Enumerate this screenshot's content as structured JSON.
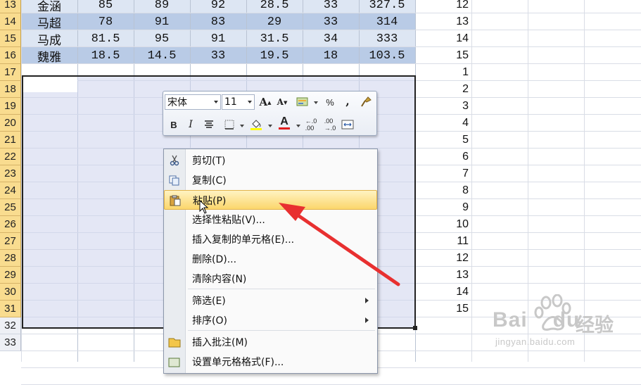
{
  "rows": [
    {
      "num": "13",
      "name": "金涵",
      "c1": "85",
      "c2": "89",
      "c3": "92",
      "c4": "28.5",
      "c5": "33",
      "total": "327.5",
      "seq": "12"
    },
    {
      "num": "14",
      "name": "马超",
      "c1": "78",
      "c2": "91",
      "c3": "83",
      "c4": "29",
      "c5": "33",
      "total": "314",
      "seq": "13"
    },
    {
      "num": "15",
      "name": "马成",
      "c1": "81.5",
      "c2": "95",
      "c3": "91",
      "c4": "31.5",
      "c5": "34",
      "total": "333",
      "seq": "14"
    },
    {
      "num": "16",
      "name": "魏雅",
      "c1": "18.5",
      "c2": "14.5",
      "c3": "33",
      "c4": "19.5",
      "c5": "18",
      "total": "103.5",
      "seq": "15"
    }
  ],
  "empty_rows": [
    "17",
    "18",
    "19",
    "20",
    "21",
    "22",
    "23",
    "24",
    "25",
    "26",
    "27",
    "28",
    "29",
    "30",
    "31"
  ],
  "empty_seq": [
    "1",
    "2",
    "3",
    "4",
    "5",
    "6",
    "7",
    "8",
    "9",
    "10",
    "11",
    "12",
    "13",
    "14",
    "15"
  ],
  "tail_rows": [
    "32",
    "33"
  ],
  "mini_toolbar": {
    "font_name": "宋体",
    "font_size": "11",
    "grow_font": "A",
    "shrink_font": "A",
    "percent": "%",
    "comma": ",",
    "bold": "B",
    "italic": "I",
    "font_color_glyph": "A",
    "highlight_color": "#ffff00",
    "font_color": "#e21f1f"
  },
  "context_menu": {
    "items": [
      {
        "label": "剪切(T)",
        "icon": "scissors-icon"
      },
      {
        "label": "复制(C)",
        "icon": "copy-icon"
      },
      {
        "label": "粘贴(P)",
        "icon": "paste-icon",
        "highlighted": true
      },
      {
        "label": "选择性粘贴(V)...",
        "icon": ""
      },
      {
        "label": "插入复制的单元格(E)...",
        "icon": ""
      },
      {
        "label": "删除(D)...",
        "icon": ""
      },
      {
        "label": "清除内容(N)",
        "icon": ""
      },
      {
        "label": "筛选(E)",
        "icon": "",
        "submenu": true
      },
      {
        "label": "排序(O)",
        "icon": "",
        "submenu": true
      },
      {
        "label": "插入批注(M)",
        "icon": "comment-icon"
      },
      {
        "label": "设置单元格格式(F)...",
        "icon": "format-cells-icon"
      }
    ]
  },
  "watermark": {
    "brand": "Bai",
    "brand2": "du",
    "brand_cn": "经验",
    "url": "jingyan.baidu.com"
  },
  "colors": {
    "row_header": "#f9dc8f",
    "band_blue": "#b9cbe6",
    "band_light": "#dde6f3",
    "selection": "#cdd4ec",
    "arrow": "#e83030"
  }
}
